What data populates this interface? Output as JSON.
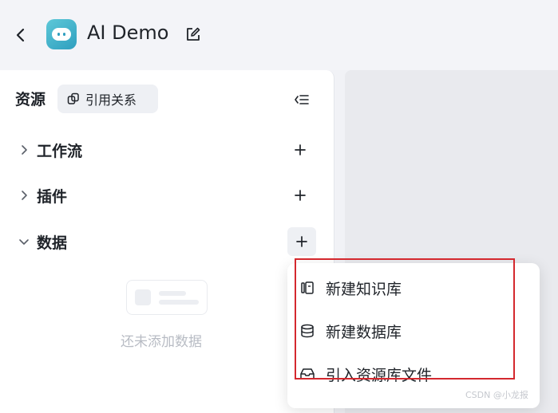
{
  "header": {
    "title": "AI Demo",
    "back_icon": "chevron-left-icon",
    "app_icon": "bot-face-icon",
    "edit_icon": "edit-icon"
  },
  "resources": {
    "title": "资源",
    "ref_button_label": "引用关系",
    "sections": [
      {
        "label": "工作流",
        "expanded": false
      },
      {
        "label": "插件",
        "expanded": false
      },
      {
        "label": "数据",
        "expanded": true
      }
    ],
    "empty_text": "还未添加数据"
  },
  "dropdown": {
    "items": [
      {
        "label": "新建知识库",
        "icon": "knowledge-base-icon"
      },
      {
        "label": "新建数据库",
        "icon": "database-icon"
      },
      {
        "label": "引入资源库文件",
        "icon": "inbox-icon"
      }
    ],
    "highlight_color": "#d4282e"
  },
  "watermark": "CSDN @小龙报",
  "colors": {
    "accent": "#2f9fbf",
    "background": "#f1f2f6"
  }
}
